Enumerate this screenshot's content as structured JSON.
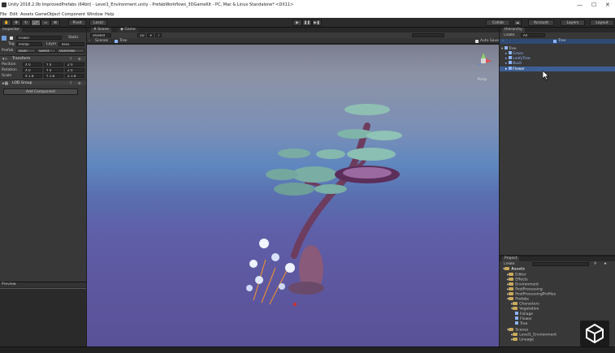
{
  "window": {
    "title": "Unity 2018.2.0b ImprovedPrefabs (64bit) - Level1_Environment.unity - PrefabWorkflows_3DGameKit - PC, Mac & Linux Standalone* <DX11>"
  },
  "menu": [
    "File",
    "Edit",
    "Assets",
    "GameObject",
    "Component",
    "Window",
    "Help"
  ],
  "toolbar": {
    "pivot": "Pivot",
    "local": "Local",
    "collab": "Collab",
    "account": "Account",
    "layers": "Layers",
    "layout": "Layout"
  },
  "inspector": {
    "tab": "Inspector",
    "object_name": "Flower",
    "static_label": "Static",
    "tag_label": "Tag",
    "tag_value": "Prefab",
    "layer_label": "Layer",
    "layer_value": "Trees",
    "prefab_label": "Prefab",
    "prefab_buttons": [
      "Open",
      "Select",
      "Overrides"
    ],
    "transform": {
      "title": "Transform",
      "rows": [
        {
          "label": "Position",
          "x": "X 0",
          "y": "Y 0",
          "z": "Z 0"
        },
        {
          "label": "Rotation",
          "x": "X 0",
          "y": "Y 0",
          "z": "Z 0"
        },
        {
          "label": "Scale",
          "x": "X 1.8",
          "y": "Y 1.8",
          "z": "Z 1.8"
        }
      ]
    },
    "lod_group": "LOD Group",
    "add_component": "Add Component",
    "lower_header": "Preview"
  },
  "scene": {
    "tabs": [
      "Scene",
      "Game"
    ],
    "shading": "Shaded",
    "mode_2d": "2D",
    "breadcrumb_scenes": "Scenes",
    "breadcrumb_tree": "Tree",
    "auto_save": "Auto Save",
    "persp": "Persp"
  },
  "hierarchy": {
    "tab": "Hierarchy",
    "create": "Create",
    "search": "All",
    "header": "Tree",
    "items": [
      "Tree",
      "Grass",
      "LeafyTree",
      "Bush",
      "Flower"
    ]
  },
  "project": {
    "tab": "Project",
    "create": "Create",
    "root": "Assets",
    "items": [
      {
        "label": "Editor",
        "indent": 1
      },
      {
        "label": "Effects",
        "indent": 1
      },
      {
        "label": "Environment",
        "indent": 1
      },
      {
        "label": "PostProcessing",
        "indent": 1
      },
      {
        "label": "PostProcessingProfiles",
        "indent": 1
      },
      {
        "label": "Prefabs",
        "indent": 1
      },
      {
        "label": "Characters",
        "indent": 2
      },
      {
        "label": "Vegetation",
        "indent": 2
      },
      {
        "label": "Foliage",
        "indent": 3
      },
      {
        "label": "Flower",
        "indent": 3
      },
      {
        "label": "Tree",
        "indent": 3
      },
      {
        "label": "Scenes",
        "indent": 1
      },
      {
        "label": "Level1_Environment",
        "indent": 2
      },
      {
        "label": "Lineage",
        "indent": 2
      }
    ]
  },
  "colors": {
    "panel": "#383838",
    "selection": "#3e5f96",
    "prefab_blue": "#8cb4ff"
  }
}
